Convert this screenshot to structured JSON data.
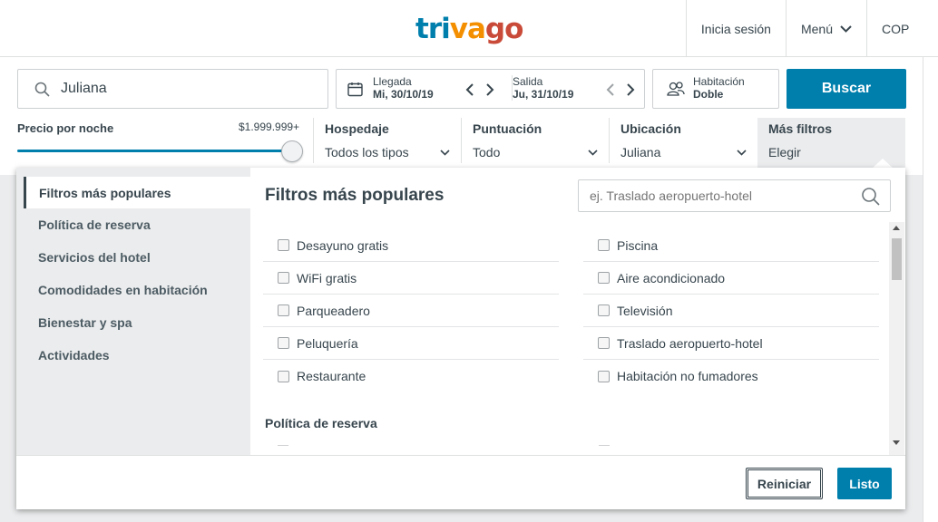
{
  "header": {
    "logo": {
      "tri": "tri",
      "va": "va",
      "go": "go"
    },
    "colors": {
      "tri": "#007fad",
      "va": "#f48f00",
      "go": "#c94a38"
    },
    "nav": {
      "login": "Inicia sesión",
      "menu": "Menú",
      "currency": "COP"
    }
  },
  "search": {
    "destination": "Juliana",
    "checkin": {
      "label": "Llegada",
      "value": "Mi, 30/10/19"
    },
    "checkout": {
      "label": "Salida",
      "value": "Ju, 31/10/19"
    },
    "room": {
      "label": "Habitación",
      "value": "Doble"
    },
    "button": "Buscar"
  },
  "filters": {
    "price": {
      "label": "Precio por noche",
      "max": "$1.999.999+",
      "level_fraction": 1.0
    },
    "hospedaje": {
      "title": "Hospedaje",
      "value": "Todos los tipos"
    },
    "puntuacion": {
      "title": "Puntuación",
      "value": "Todo"
    },
    "ubicacion": {
      "title": "Ubicación",
      "value": "Juliana"
    },
    "mas": {
      "title": "Más filtros",
      "value": "Elegir"
    }
  },
  "popup": {
    "sidebar": [
      "Filtros más populares",
      "Política de reserva",
      "Servicios del hotel",
      "Comodidades en habitación",
      "Bienestar y spa",
      "Actividades"
    ],
    "title": "Filtros más populares",
    "search_placeholder": "ej. Traslado aeropuerto-hotel",
    "left_options": [
      "Desayuno gratis",
      "WiFi gratis",
      "Parqueadero",
      "Peluquería",
      "Restaurante"
    ],
    "right_options": [
      "Piscina",
      "Aire acondicionado",
      "Televisión",
      "Traslado aeropuerto-hotel",
      "Habitación no fumadores"
    ],
    "section_title": "Política de reserva",
    "reset": "Reiniciar",
    "done": "Listo"
  }
}
